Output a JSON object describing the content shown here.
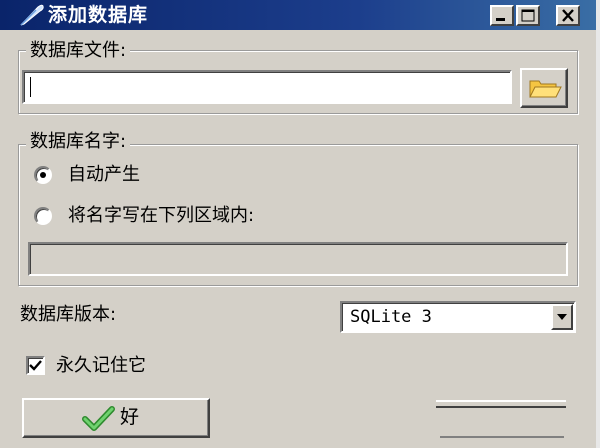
{
  "window": {
    "title": "添加数据库",
    "controls": {
      "minimize": "minimize-icon",
      "maximize": "maximize-icon",
      "close": "close-icon"
    }
  },
  "file_group": {
    "label": "数据库文件:",
    "path_value": "",
    "browse_icon": "folder-icon"
  },
  "name_group": {
    "label": "数据库名字:",
    "options": [
      {
        "label": "自动产生",
        "selected": true
      },
      {
        "label": "将名字写在下列区域内:",
        "selected": false
      }
    ],
    "custom_name_value": ""
  },
  "version": {
    "label": "数据库版本:",
    "selected": "SQLite 3"
  },
  "remember": {
    "label": "永久记住它",
    "checked": true
  },
  "ok_button": {
    "label": "好",
    "icon": "checkmark-icon"
  },
  "colors": {
    "title_bar": "#0a246a",
    "face": "#d4d0c8",
    "check_green": "#3caa3c"
  }
}
